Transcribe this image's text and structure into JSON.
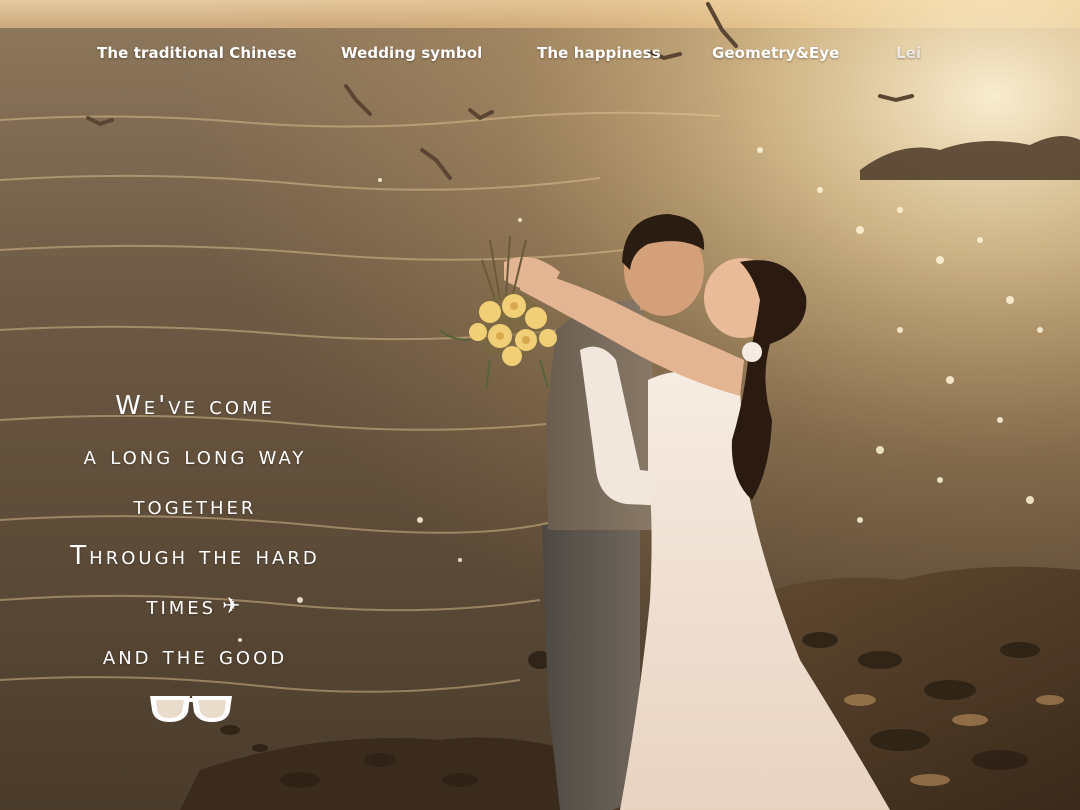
{
  "nav": {
    "items": [
      {
        "label": "The traditional Chinese"
      },
      {
        "label": "Wedding symbol"
      },
      {
        "label": "The happiness"
      },
      {
        "label": "Geometry&Eye"
      },
      {
        "label": "Lei"
      }
    ]
  },
  "poem": {
    "lines": [
      "We've come",
      "a long long way",
      "together",
      "Through the hard",
      "times",
      "and the good"
    ],
    "plane_glyph": "✈"
  },
  "icons": {
    "plane": "airplane-icon",
    "glasses": "sunglasses-icon"
  },
  "colors": {
    "sunset": "#d9b07a",
    "water_dark": "#3b2f22",
    "text": "#ffffff"
  }
}
